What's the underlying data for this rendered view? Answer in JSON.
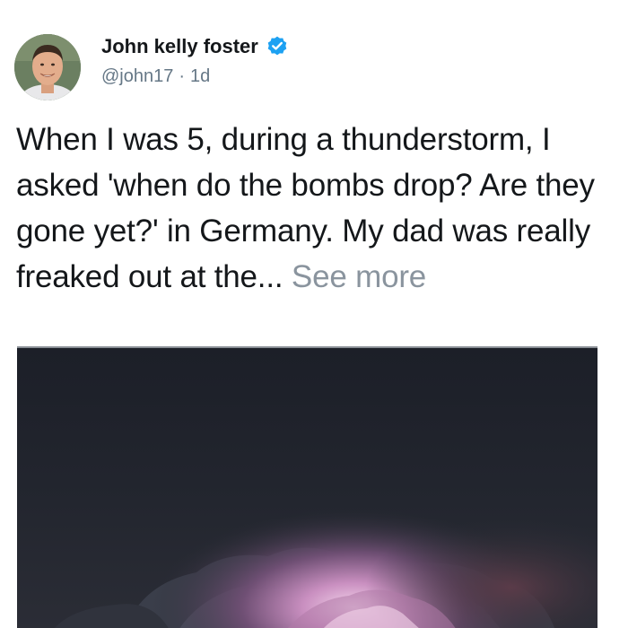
{
  "author": {
    "name": "John kelly foster",
    "handle": "@john17",
    "separator": "·",
    "time": "1d",
    "verified_icon": "verified-badge-icon",
    "verified_color": "#1da1f2"
  },
  "post": {
    "text": "When I was 5, during a thunderstorm, I asked 'when do the bombs drop? Are they gone yet?' in Germany. My dad was really freaked out at the...",
    "see_more": "See more"
  },
  "colors": {
    "text": "#14171a",
    "muted": "#657786",
    "see_more": "#8a949e"
  }
}
